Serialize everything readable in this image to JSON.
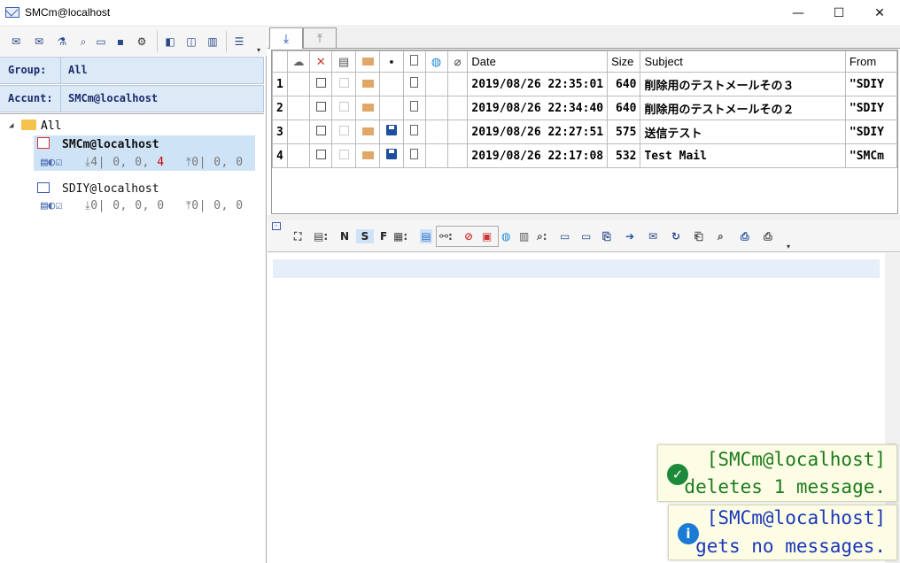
{
  "window": {
    "title": "SMCm@localhost",
    "min": "—",
    "max": "☐",
    "close": "✕"
  },
  "sidebar": {
    "group_label": "Group:",
    "group_value": "All",
    "account_label": "Accunt:",
    "account_value": "SMCm@localhost",
    "tree": {
      "root": "All",
      "accounts": [
        {
          "name": "SMCm@localhost",
          "recv": "4",
          "recv_rest": "| 0, 0,",
          "recv_red": "4",
          "send": "0",
          "send_rest": "| 0, 0"
        },
        {
          "name": "SDIY@localhost",
          "recv": "0",
          "recv_rest": "| 0, 0, 0",
          "recv_red": "",
          "send": "0",
          "send_rest": "| 0, 0"
        }
      ]
    }
  },
  "mail_list": {
    "columns": [
      "Date",
      "Size",
      "Subject",
      "From"
    ],
    "rows": [
      {
        "n": "1",
        "date": "2019/08/26 22:35:01",
        "size": "640",
        "subject": "削除用のテストメールその３",
        "from": "\"SDIY"
      },
      {
        "n": "2",
        "date": "2019/08/26 22:34:40",
        "size": "640",
        "subject": "削除用のテストメールその２",
        "from": "\"SDIY"
      },
      {
        "n": "3",
        "date": "2019/08/26 22:27:51",
        "size": "575",
        "subject": "送信テスト",
        "from": "\"SDIY"
      },
      {
        "n": "4",
        "date": "2019/08/26 22:17:08",
        "size": "532",
        "subject": "Test Mail",
        "from": "\"SMCm"
      }
    ]
  },
  "view_toolbar": {
    "n": "N",
    "s": "S",
    "f": "F"
  },
  "toasts": [
    {
      "line1": "[SMCm@localhost]",
      "line2": "deletes 1 message.",
      "kind": "success",
      "color": "#1c7a1c"
    },
    {
      "line1": "[SMCm@localhost]",
      "line2": "gets no messages.",
      "kind": "info",
      "color": "#1a37b8"
    }
  ]
}
